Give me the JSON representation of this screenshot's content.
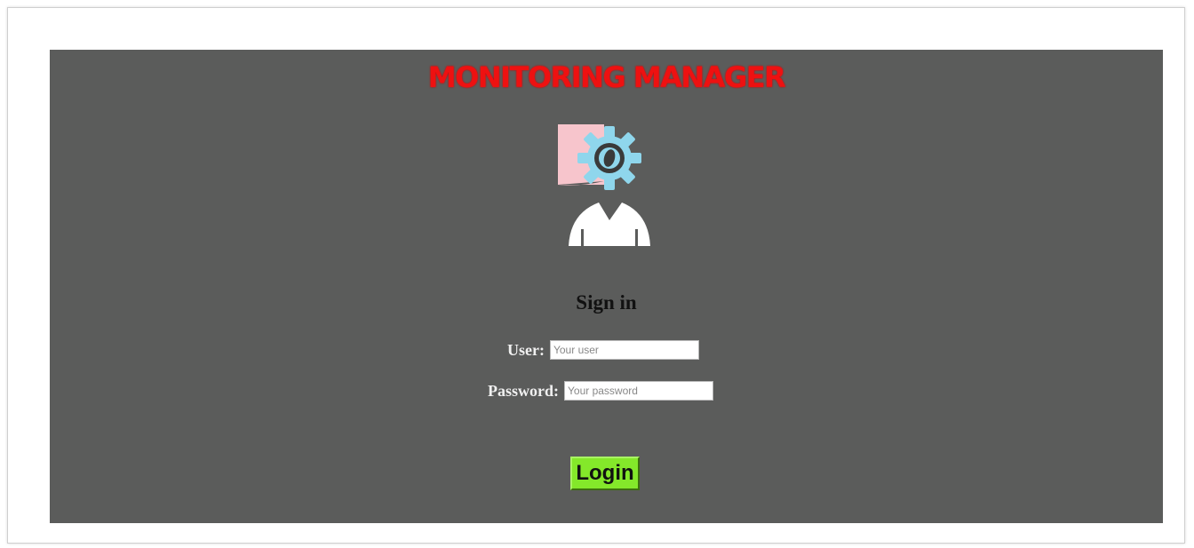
{
  "header": {
    "title": "MONITORING MANAGER",
    "title_color": "#ee1111"
  },
  "logo": {
    "icon": "user-gear-icon",
    "colors": {
      "doc": "#f7c5cc",
      "gear": "#8fd6ec",
      "person": "#ffffff"
    }
  },
  "form": {
    "heading": "Sign in",
    "user_label": "User:",
    "user_placeholder": "Your user",
    "user_value": "",
    "password_label": "Password:",
    "password_placeholder": "Your password",
    "password_value": "",
    "login_label": "Login",
    "login_color": "#84e82a"
  },
  "theme": {
    "panel_bg": "#5b5c5b",
    "page_bg": "#ffffff"
  }
}
